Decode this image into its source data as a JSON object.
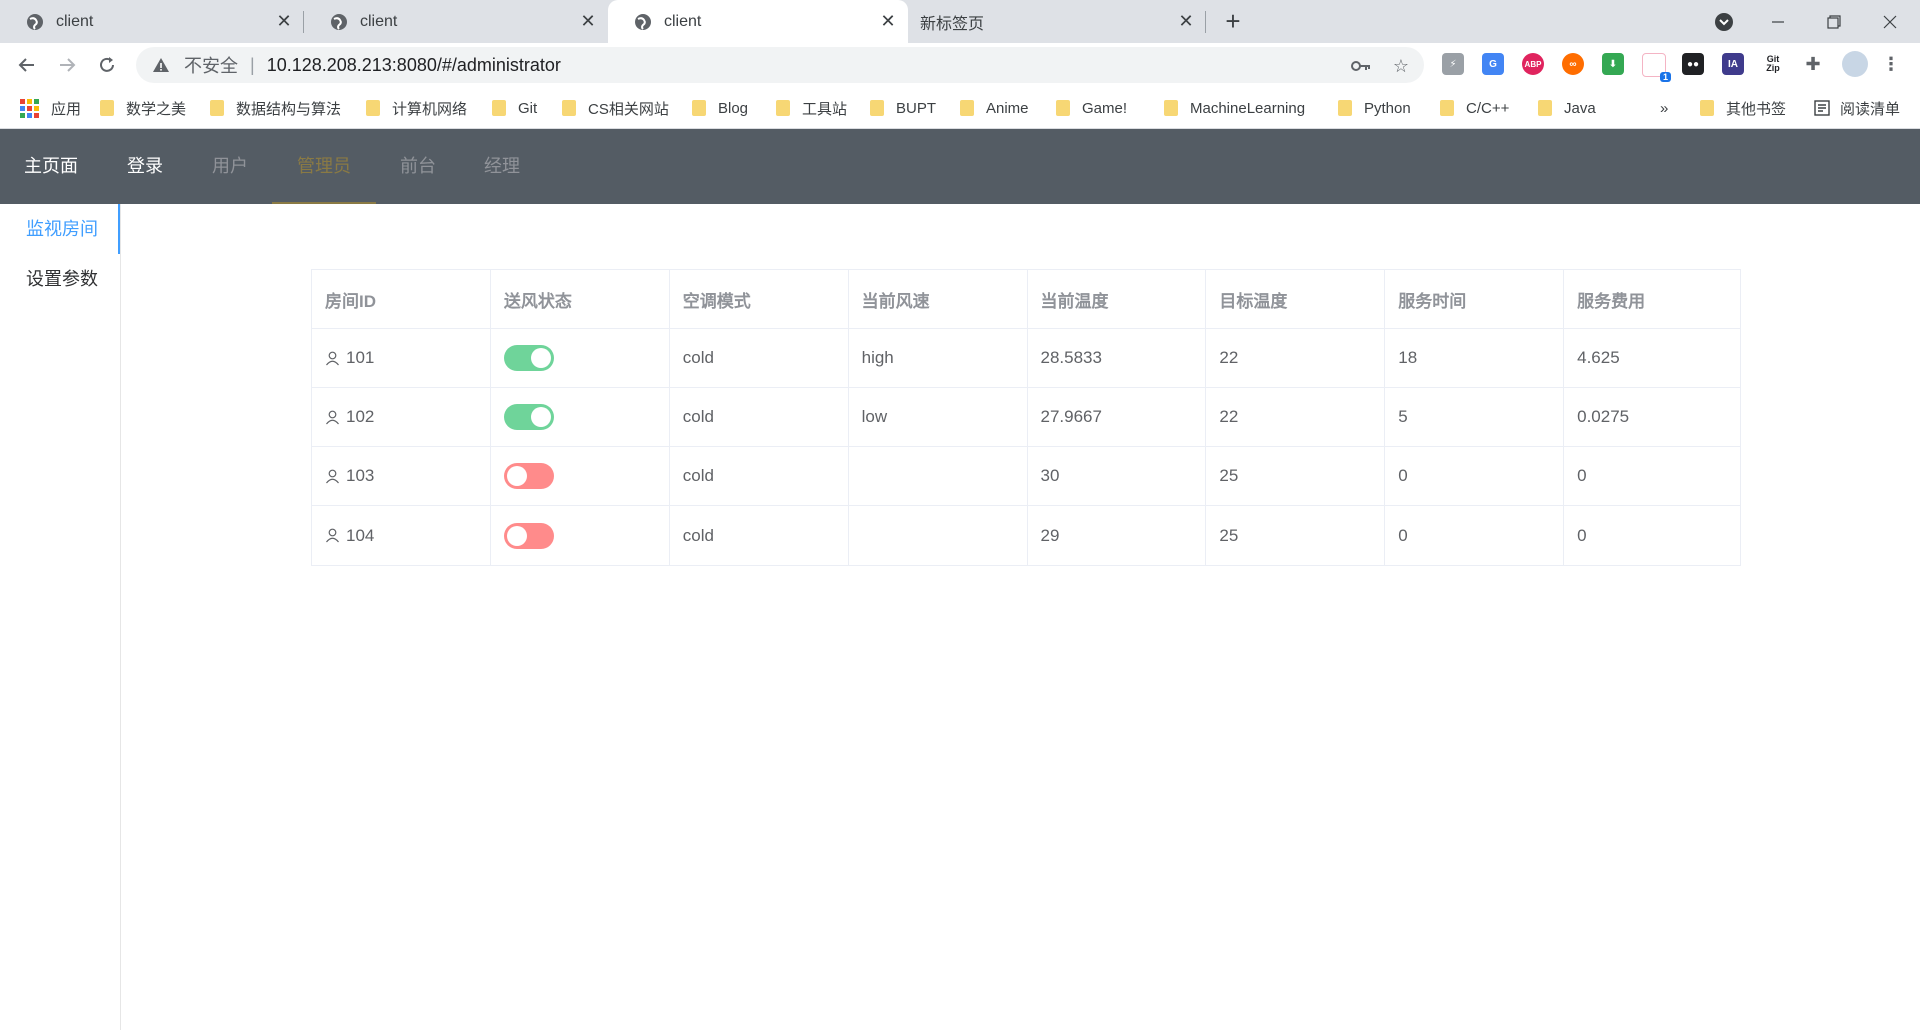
{
  "browser": {
    "tabs": [
      {
        "title": "client",
        "active": false
      },
      {
        "title": "client",
        "active": false
      },
      {
        "title": "client",
        "active": true
      },
      {
        "title": "新标签页",
        "active": false
      }
    ],
    "security_label": "不安全",
    "url": "10.128.208.213:8080/#/administrator",
    "bookmarks": [
      "应用",
      "数学之美",
      "数据结构与算法",
      "计算机网络",
      "Git",
      "CS相关网站",
      "Blog",
      "工具站",
      "BUPT",
      "Anime",
      "Game!",
      "MachineLearning",
      "Python",
      "C/C++",
      "Java"
    ],
    "other_bookmarks": "其他书签",
    "reading_list": "阅读清单",
    "overflow": "»",
    "extensions": [
      "translate-ext",
      "abp-ext",
      "infinity-ext",
      "download-ext",
      "cat-ext",
      "tampermonkey-ext",
      "ia-ext",
      "gitzip-ext",
      "puzzle-icon"
    ],
    "ext_labels": {
      "abp": "ABP",
      "ia": "IA",
      "gitzip_top": "Git",
      "gitzip_bottom": "Zip",
      "cat_badge": "1"
    }
  },
  "app": {
    "nav": [
      {
        "label": "主页面",
        "state": "normal"
      },
      {
        "label": "登录",
        "state": "normal"
      },
      {
        "label": "用户",
        "state": "disabled"
      },
      {
        "label": "管理员",
        "state": "active"
      },
      {
        "label": "前台",
        "state": "disabled"
      },
      {
        "label": "经理",
        "state": "disabled"
      }
    ],
    "side": [
      {
        "label": "监视房间",
        "active": true
      },
      {
        "label": "设置参数",
        "active": false
      }
    ],
    "table": {
      "headers": [
        "房间ID",
        "送风状态",
        "空调模式",
        "当前风速",
        "当前温度",
        "目标温度",
        "服务时间",
        "服务费用"
      ],
      "rows": [
        {
          "id": "101",
          "on": true,
          "mode": "cold",
          "speed": "high",
          "cur": "28.5833",
          "target": "22",
          "time": "18",
          "fee": "4.625"
        },
        {
          "id": "102",
          "on": true,
          "mode": "cold",
          "speed": "low",
          "cur": "27.9667",
          "target": "22",
          "time": "5",
          "fee": "0.0275"
        },
        {
          "id": "103",
          "on": false,
          "mode": "cold",
          "speed": "",
          "cur": "30",
          "target": "25",
          "time": "0",
          "fee": "0"
        },
        {
          "id": "104",
          "on": false,
          "mode": "cold",
          "speed": "",
          "cur": "29",
          "target": "25",
          "time": "0",
          "fee": "0"
        }
      ]
    },
    "colors": {
      "switch_on": "#6fd49a",
      "switch_off": "#ff8b8b",
      "accent": "#409eff",
      "header_bg": "#545c64",
      "active_nav": "#8a7a44"
    }
  }
}
